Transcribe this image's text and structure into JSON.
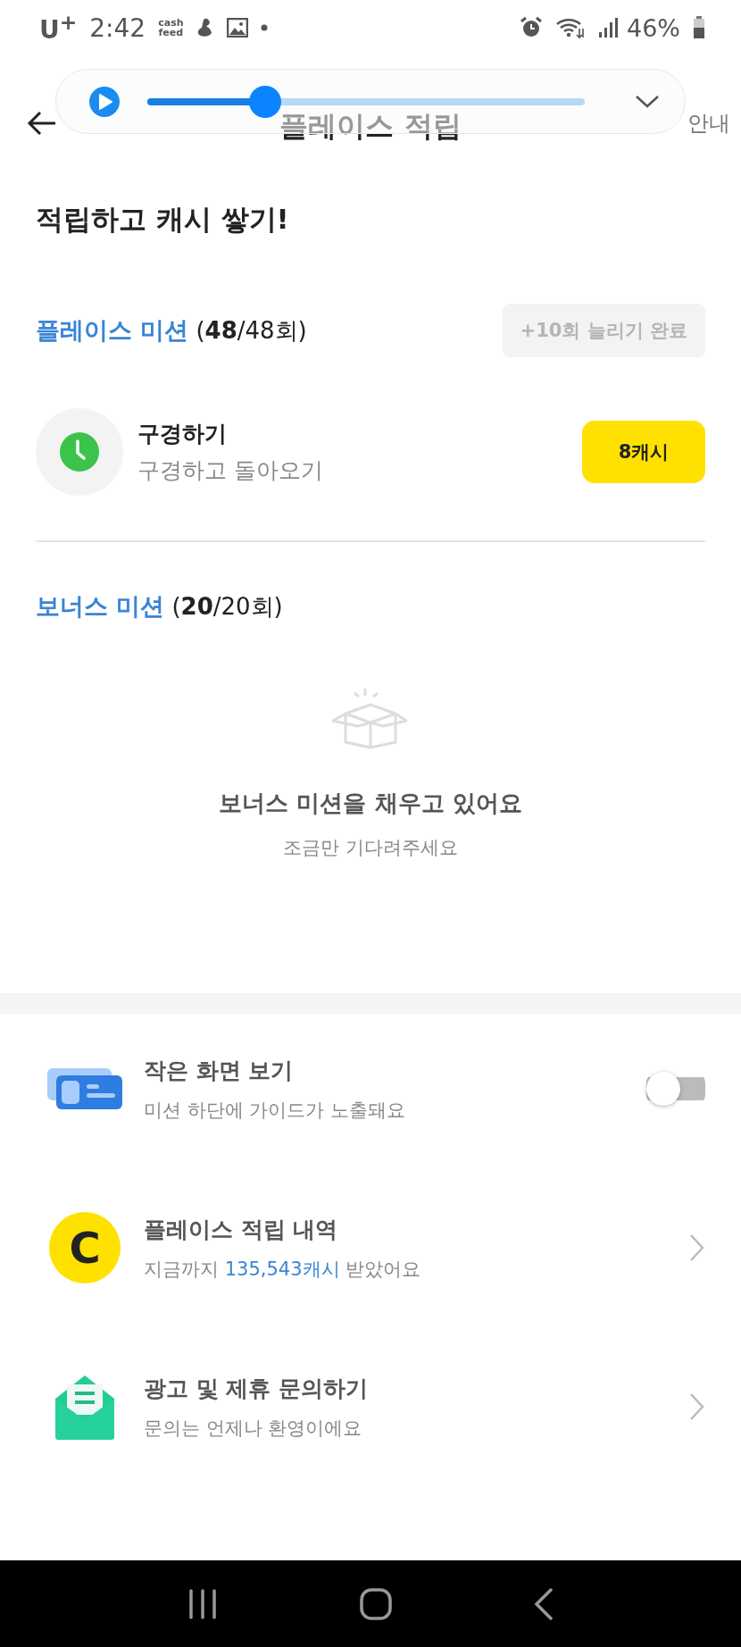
{
  "status_bar": {
    "carrier": "U$^{+}$",
    "time": "2:42",
    "app_badge": [
      "cash",
      "feed"
    ],
    "battery": "46%"
  },
  "player": {
    "level": 0.27
  },
  "header": {
    "title": "플레이스 적립",
    "info": "안내"
  },
  "headline": "적립하고 캐시 쌓기!",
  "place_mission": {
    "title": "플레이스 미션",
    "count": "(**48**/48회)",
    "extend_button": "+10회 늘리기 완료",
    "items": [
      {
        "title": "구경하기",
        "subtitle": "구경하고 돌아오기",
        "reward": "8캐시"
      }
    ]
  },
  "bonus_mission": {
    "title": "보너스 미션",
    "count": "(**20**/20회)",
    "empty_title": "보너스 미션을 채우고 있어요",
    "empty_subtitle": "조금만 기다려주세요"
  },
  "settings": [
    {
      "kind": "toggle",
      "title": "작은 화면 보기",
      "subtitle": [
        "미션 하단에 가이드가 노출돼요"
      ],
      "on": false
    },
    {
      "kind": "link",
      "title": "플레이스 적립 내역",
      "badge": "C",
      "subtitle": [
        "지금까지 ",
        "135,543캐시",
        " 받았어요"
      ]
    },
    {
      "kind": "link",
      "title": "광고 및 제휴 문의하기",
      "subtitle": [
        "문의는 언제나 환영이에요"
      ]
    }
  ]
}
